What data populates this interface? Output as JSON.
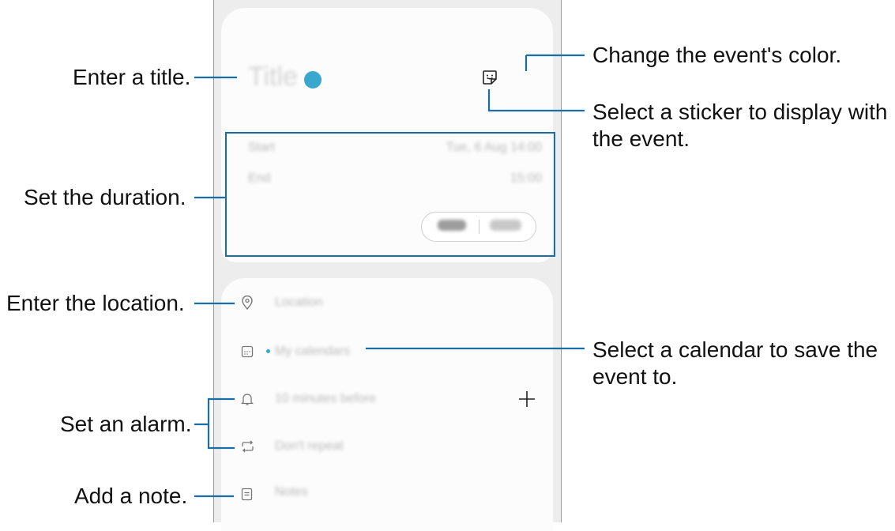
{
  "screen": {
    "title_placeholder": "Title",
    "start_label": "Start",
    "start_value": "Tue, 6 Aug 14:00",
    "end_label": "End",
    "end_value": "15:00",
    "toggle_left": "Hours",
    "toggle_right": "All day",
    "location_label": "Location",
    "calendar_label": "My calendars",
    "alarm_label": "10 minutes before",
    "repeat_label": "Don't repeat",
    "notes_label": "Notes",
    "add_alarm": "+"
  },
  "callouts": {
    "title": "Enter a title.",
    "duration": "Set the duration.",
    "location": "Enter the location.",
    "alarm": "Set an alarm.",
    "note": "Add a note.",
    "color": "Change the event's color.",
    "sticker": "Select a sticker to display with\nthe event.",
    "calendar": "Select a calendar to save the\nevent to."
  },
  "colors": {
    "accent": "#3aa7cc",
    "callout_line": "#1a6ea6"
  }
}
